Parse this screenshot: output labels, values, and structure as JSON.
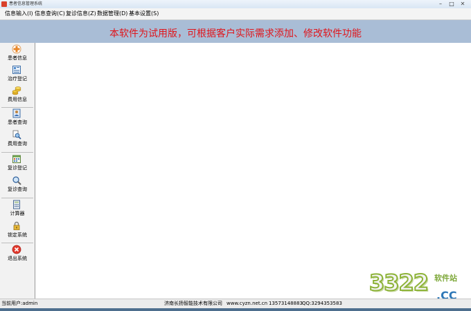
{
  "window": {
    "title": "患者信息管理系统",
    "minimize_label": "–",
    "maximize_label": "□",
    "close_label": "✕"
  },
  "menu": [
    {
      "label": "信息输入(I)"
    },
    {
      "label": "信息查询(C)"
    },
    {
      "label": "复诊信息(Z)"
    },
    {
      "label": "数据管理(D)"
    },
    {
      "label": "基本设置(S)"
    }
  ],
  "banner": {
    "text": "本软件为试用版，可根据客户实际需求添加、修改软件功能"
  },
  "sidebar": {
    "items": [
      {
        "label": "患者信息",
        "icon": "add-patient-icon"
      },
      {
        "label": "治疗登记",
        "icon": "register-form-icon"
      },
      {
        "label": "费用信息",
        "icon": "coins-icon"
      },
      {
        "label": "患者查询",
        "icon": "patient-card-icon"
      },
      {
        "label": "费用查询",
        "icon": "search-document-icon"
      },
      {
        "label": "复诊登记",
        "icon": "calendar-icon"
      },
      {
        "label": "复诊查询",
        "icon": "magnifier-icon"
      },
      {
        "label": "计算器",
        "icon": "calculator-icon"
      },
      {
        "label": "锁定系统",
        "icon": "lock-icon"
      },
      {
        "label": "退出系统",
        "icon": "exit-icon"
      }
    ]
  },
  "status": {
    "user": "当前用户:admin",
    "company": "济南长扬智能技术有限公司",
    "website": "www.cyzn.net.cn",
    "phone": "13573148883",
    "qq": "QQ:3294353583"
  },
  "watermark": {
    "number": "3322",
    "site": "软件站",
    "domain": ".CC"
  },
  "colors": {
    "banner_bg": "#a9bdd6",
    "banner_text": "#e0151b",
    "workspace_bg": "#ffffff"
  }
}
